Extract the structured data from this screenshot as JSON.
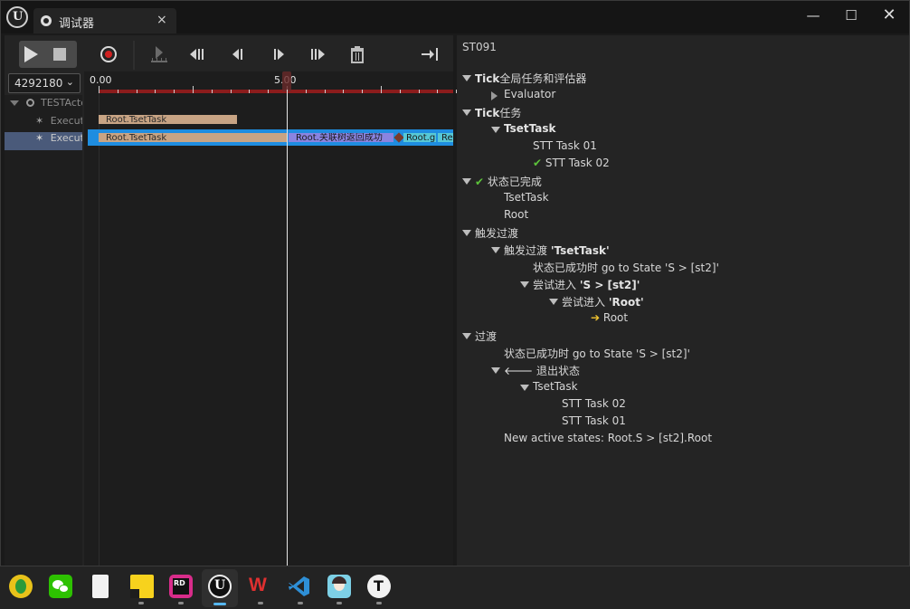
{
  "window": {
    "tab_title": "调试器",
    "tab_close": "×",
    "controls": {
      "minimize": "—",
      "maximize": "☐",
      "close": "✕"
    }
  },
  "toolbar": {
    "buttons": [
      "play",
      "stop",
      "record",
      "step-into",
      "step-back-frame",
      "step-back",
      "step-forward",
      "step-forward-frame",
      "clear",
      "jump-to-end"
    ]
  },
  "instance_selector": {
    "value": "4292180",
    "arrow": "⌄"
  },
  "tree": {
    "items": [
      {
        "label": "TESTActor",
        "expanded": true
      },
      {
        "label": "Executor"
      },
      {
        "label": "Executor"
      }
    ]
  },
  "timeline": {
    "ruler": {
      "start_label": "0.00",
      "mid_label": "5.00"
    },
    "track1": {
      "segments": [
        {
          "label": "Root.TsetTask",
          "color": "#c8a484"
        }
      ]
    },
    "track2": {
      "segments": [
        {
          "label": "Root.TsetTask",
          "color": "#c8a484"
        },
        {
          "label": "Root.关联树返回成功",
          "color": "#8a84e0"
        },
        {
          "label": "Root.g",
          "color": "#57c8d6"
        },
        {
          "label": "Re",
          "color": "#57c8d6"
        }
      ]
    }
  },
  "details": {
    "header": "ST091",
    "lines": [
      {
        "prefix": "Tick",
        "text": "全局任务和评估器"
      },
      {
        "text": "Evaluator"
      },
      {
        "prefix": "Tick",
        "text": "任务"
      },
      {
        "bold": "TsetTask"
      },
      {
        "text": "STT Task 01"
      },
      {
        "icon": "✔",
        "text": "STT Task 02"
      },
      {
        "icon": "✔",
        "text": "状态已完成"
      },
      {
        "text": "TsetTask"
      },
      {
        "text": "Root"
      },
      {
        "text": "触发过渡"
      },
      {
        "text": "触发过渡 ",
        "bold": "'TsetTask'"
      },
      {
        "text": "状态已成功时 go to State 'S > [st2]'"
      },
      {
        "text": "尝试进入 ",
        "bold": "'S > [st2]'"
      },
      {
        "text": "尝试进入 ",
        "bold": "'Root'"
      },
      {
        "icon": "➔",
        "text": "Root"
      },
      {
        "text": "过渡"
      },
      {
        "text": "状态已成功时 go to State 'S > [st2]'"
      },
      {
        "icon": "🡐",
        "text": "退出状态"
      },
      {
        "text": "TsetTask"
      },
      {
        "text": "STT Task 02"
      },
      {
        "text": "STT Task 01"
      },
      {
        "text": "New active states: Root.S > [st2].Root"
      }
    ]
  },
  "taskbar": {
    "apps": [
      {
        "name": "green-circle-app",
        "color": "#e8c21a"
      },
      {
        "name": "wechat",
        "color": "#2dc100"
      },
      {
        "name": "document",
        "color": "#f2f2f2"
      },
      {
        "name": "sticky-notes",
        "color": "#f7d21d"
      },
      {
        "name": "rider",
        "color": "#d82c8a"
      },
      {
        "name": "unreal-engine",
        "color": "#1b1b1b"
      },
      {
        "name": "wps",
        "color": "#d83030"
      },
      {
        "name": "vscode",
        "color": "#2e8fd6"
      },
      {
        "name": "avatar-app",
        "color": "#7dd0e6"
      },
      {
        "name": "typora",
        "color": "#f2f2f2"
      }
    ],
    "labels": {
      "rider": "RD",
      "typora": "T",
      "wps": "W"
    }
  }
}
